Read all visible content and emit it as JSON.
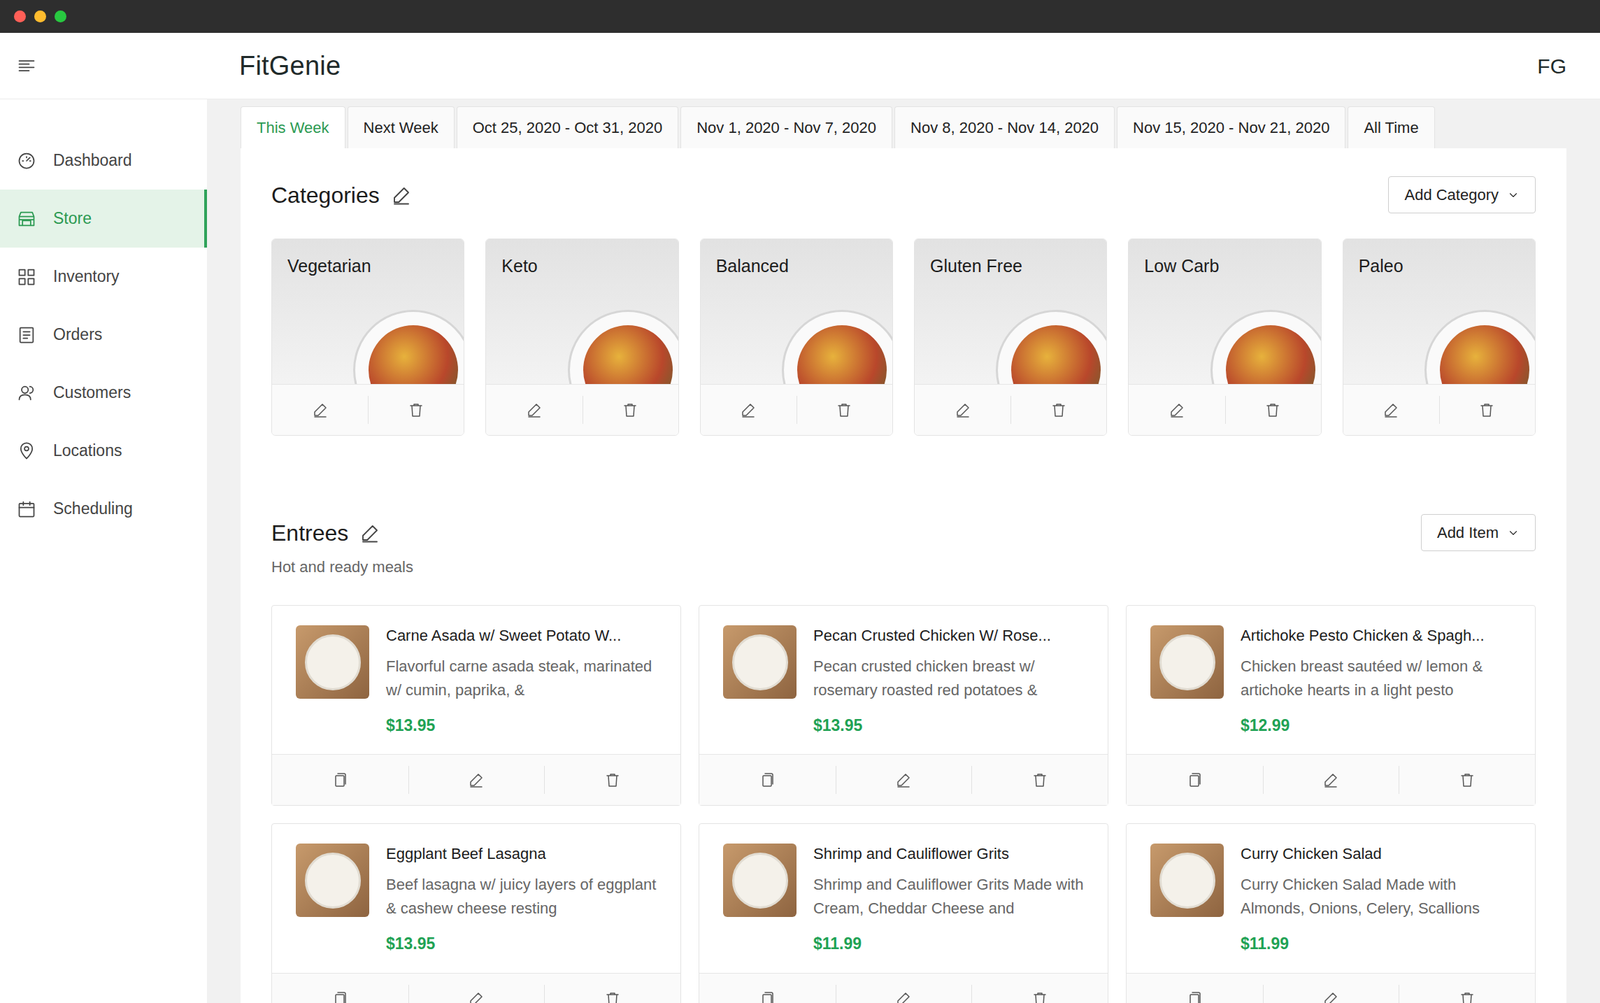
{
  "brand": {
    "logo": "FitGenie",
    "avatar": "FG"
  },
  "sidebar": {
    "items": [
      {
        "label": "Dashboard",
        "selected": false
      },
      {
        "label": "Store",
        "selected": true
      },
      {
        "label": "Inventory",
        "selected": false
      },
      {
        "label": "Orders",
        "selected": false
      },
      {
        "label": "Customers",
        "selected": false
      },
      {
        "label": "Locations",
        "selected": false
      },
      {
        "label": "Scheduling",
        "selected": false
      }
    ]
  },
  "tabs": [
    {
      "label": "This Week",
      "selected": true
    },
    {
      "label": "Next Week",
      "selected": false
    },
    {
      "label": "Oct 25, 2020 - Oct 31, 2020",
      "selected": false
    },
    {
      "label": "Nov 1, 2020 - Nov 7, 2020",
      "selected": false
    },
    {
      "label": "Nov 8, 2020 - Nov 14, 2020",
      "selected": false
    },
    {
      "label": "Nov 15, 2020 - Nov 21, 2020",
      "selected": false
    },
    {
      "label": "All Time",
      "selected": false
    }
  ],
  "categories": {
    "title": "Categories",
    "add_button": "Add Category",
    "items": [
      {
        "name": "Vegetarian"
      },
      {
        "name": "Keto"
      },
      {
        "name": "Balanced"
      },
      {
        "name": "Gluten Free"
      },
      {
        "name": "Low Carb"
      },
      {
        "name": "Paleo"
      }
    ]
  },
  "entrees": {
    "title": "Entrees",
    "subtitle": "Hot and ready meals",
    "add_button": "Add Item",
    "items": [
      {
        "name": "Carne Asada w/ Sweet Potato W...",
        "description": "Flavorful carne asada steak, marinated w/ cumin, paprika, &",
        "price": "$13.95"
      },
      {
        "name": "Pecan Crusted Chicken W/ Rose...",
        "description": "Pecan crusted chicken breast w/ rosemary roasted red potatoes &",
        "price": "$13.95"
      },
      {
        "name": "Artichoke Pesto Chicken & Spagh...",
        "description": "Chicken breast sautéed w/ lemon & artichoke hearts in a light pesto",
        "price": "$12.99"
      },
      {
        "name": "Eggplant Beef Lasagna",
        "description": "Beef lasagna w/ juicy layers of eggplant & cashew cheese resting",
        "price": "$13.95"
      },
      {
        "name": "Shrimp and Cauliflower Grits",
        "description": "Shrimp and Cauliflower Grits Made with Cream, Cheddar Cheese and",
        "price": "$11.99"
      },
      {
        "name": "Curry Chicken Salad",
        "description": "Curry Chicken Salad Made with Almonds, Onions, Celery, Scallions",
        "price": "$11.99"
      }
    ]
  }
}
